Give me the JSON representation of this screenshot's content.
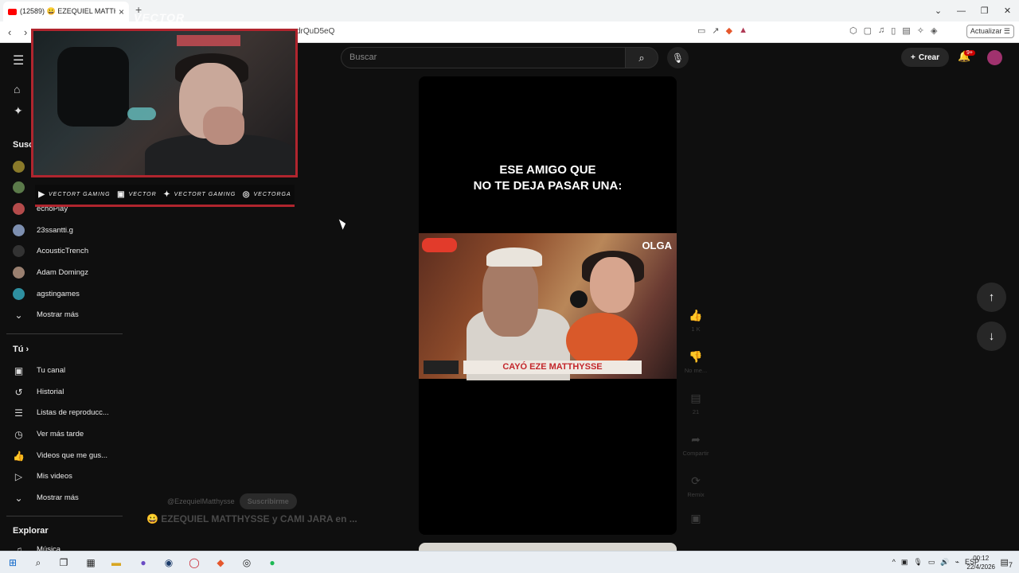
{
  "browser": {
    "tab_title": "(12589) 😀 EZEQUIEL MATTHY...",
    "new_tab": "+",
    "url": "drQuD5eQ",
    "update_label": "Actualizar",
    "window_controls": [
      "⌄",
      "—",
      "❐",
      "✕"
    ]
  },
  "header": {
    "search_placeholder": "Buscar",
    "create_label": "Crear",
    "notif_count": "9+"
  },
  "overlay": {
    "logo_text": "VECTOR",
    "social": [
      {
        "icon": "youtube-icon",
        "glyph": "▶",
        "text": "VECTORT GAMING"
      },
      {
        "icon": "twitch-icon",
        "glyph": "▣",
        "text": "VECTOR"
      },
      {
        "icon": "twitter-icon",
        "glyph": "✦",
        "text": "VECTORT GAMING"
      },
      {
        "icon": "instagram-icon",
        "glyph": "◎",
        "text": "VECTORGA"
      }
    ]
  },
  "sidebar": {
    "subs_header": "Susc",
    "subscriptions": [
      {
        "label": "",
        "color": "#8a7a2a"
      },
      {
        "label": "",
        "color": "#5b7a4a"
      },
      {
        "label": "echoPlay",
        "color": "#b44b4b"
      },
      {
        "label": "23ssantti.g",
        "color": "#7d8fb0"
      },
      {
        "label": "AcousticTrench",
        "color": "#333333"
      },
      {
        "label": "Adam Domingz",
        "color": "#9a8070"
      },
      {
        "label": "agstingames",
        "color": "#2e8fa0"
      }
    ],
    "show_more": "Mostrar más",
    "you_header": "Tú",
    "you_items": [
      {
        "label": "Tu canal",
        "icon": "channel-icon",
        "glyph": "▣"
      },
      {
        "label": "Historial",
        "icon": "history-icon",
        "glyph": "↺"
      },
      {
        "label": "Listas de reproducc...",
        "icon": "playlist-icon",
        "glyph": "☰"
      },
      {
        "label": "Ver más tarde",
        "icon": "clock-icon",
        "glyph": "◷"
      },
      {
        "label": "Videos que me gus...",
        "icon": "like-icon",
        "glyph": "👍"
      },
      {
        "label": "Mis videos",
        "icon": "video-icon",
        "glyph": "▷"
      }
    ],
    "show_more2": "Mostrar más",
    "explore_header": "Explorar",
    "explore_items": [
      {
        "label": "Música",
        "icon": "music-icon",
        "glyph": "♫"
      }
    ]
  },
  "player": {
    "caption_line1": "ESE AMIGO QUE",
    "caption_line2": "NO TE DEJA PASAR UNA:",
    "frame_tag": "OLGA",
    "frame_banner": "CAYÓ EZE MATTHYSSE"
  },
  "actions": {
    "like_count": "1 K",
    "dislike_label": "No me...",
    "comments_count": "21",
    "share_label": "Compartir",
    "remix_label": "Remix"
  },
  "video_info": {
    "channel": "@EzequielMatthysse",
    "subscribe": "Suscribirme",
    "title": "😀 EZEQUIEL MATTHYSSE y CAMI JARA en ..."
  },
  "taskbar": {
    "lang": "ESP",
    "time": "00:12",
    "date": "22/4/2026",
    "notif": "7"
  }
}
